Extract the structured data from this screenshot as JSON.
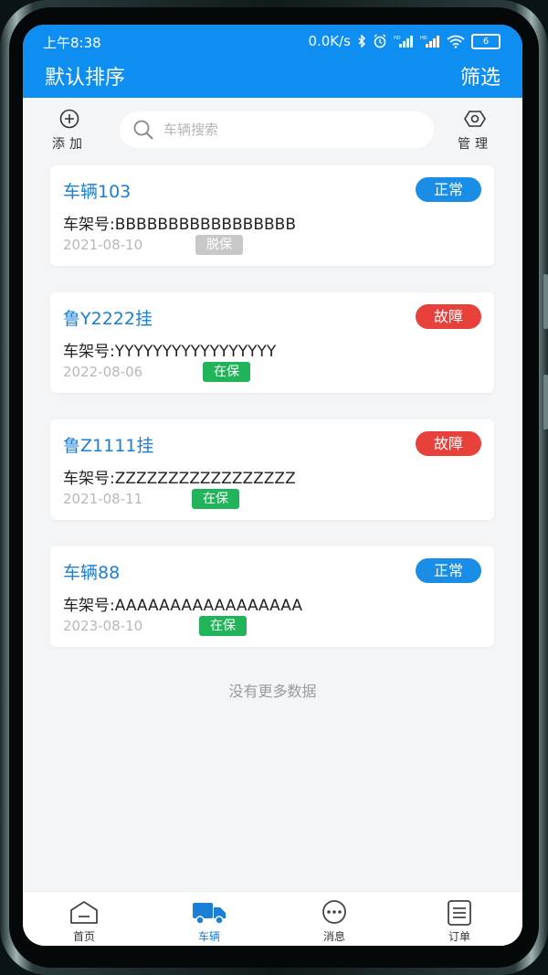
{
  "statusbar": {
    "time": "上午8:38",
    "net_speed": "0.0K/s",
    "battery": "6"
  },
  "header": {
    "title": "默认排序",
    "filter_label": "筛选"
  },
  "toolbar": {
    "add_label": "添加",
    "manage_label": "管理",
    "search_placeholder": "车辆搜索"
  },
  "vehicles": [
    {
      "name": "车辆103",
      "status": "正常",
      "vin": "车架号:BBBBBBBBBBBBBBBBB",
      "date": "2021-08-10",
      "insurance": "脱保"
    },
    {
      "name": "鲁Y2222挂",
      "status": "故障",
      "vin": "车架号:YYYYYYYYYYYYYYYYY",
      "date": "2022-08-06",
      "insurance": "在保"
    },
    {
      "name": "鲁Z1111挂",
      "status": "故障",
      "vin": "车架号:ZZZZZZZZZZZZZZZZZ",
      "date": "2021-08-11",
      "insurance": "在保"
    },
    {
      "name": "车辆88",
      "status": "正常",
      "vin": "车架号:AAAAAAAAAAAAAAAAA",
      "date": "2023-08-10",
      "insurance": "在保"
    }
  ],
  "list_footer": "没有更多数据",
  "tabs": [
    {
      "label": "首页",
      "icon": "home-icon"
    },
    {
      "label": "车辆",
      "icon": "truck-icon"
    },
    {
      "label": "消息",
      "icon": "message-icon"
    },
    {
      "label": "订单",
      "icon": "order-icon"
    }
  ],
  "colors": {
    "primary": "#0e8ef0",
    "status_normal": "#1a8ee6",
    "status_fault": "#e8403a",
    "insured": "#22b45a",
    "uninsured": "#c8c8c8"
  }
}
